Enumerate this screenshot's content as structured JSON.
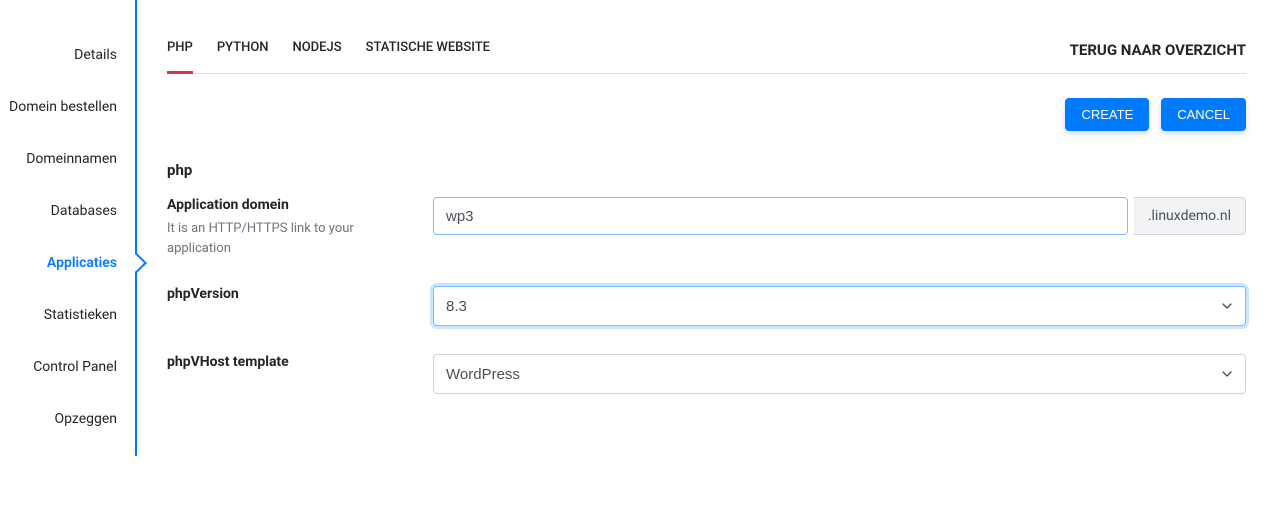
{
  "sidebar": {
    "items": [
      {
        "label": "Details"
      },
      {
        "label": "Domein bestellen"
      },
      {
        "label": "Domeinnamen"
      },
      {
        "label": "Databases"
      },
      {
        "label": "Applicaties"
      },
      {
        "label": "Statistieken"
      },
      {
        "label": "Control Panel"
      },
      {
        "label": "Opzeggen"
      }
    ]
  },
  "tabs": [
    {
      "label": "PHP"
    },
    {
      "label": "PYTHON"
    },
    {
      "label": "NODEJS"
    },
    {
      "label": "STATISCHE WEBSITE"
    }
  ],
  "back_link": "TERUG NAAR OVERZICHT",
  "buttons": {
    "create": "CREATE",
    "cancel": "CANCEL"
  },
  "form": {
    "section_title": "php",
    "domain": {
      "label": "Application domein",
      "help": "It is an HTTP/HTTPS link to your application",
      "value": "wp3",
      "suffix": ".linuxdemo.nl"
    },
    "phpVersion": {
      "label": "phpVersion",
      "value": "8.3"
    },
    "phpVhost": {
      "label": "phpVHost template",
      "value": "WordPress"
    }
  }
}
